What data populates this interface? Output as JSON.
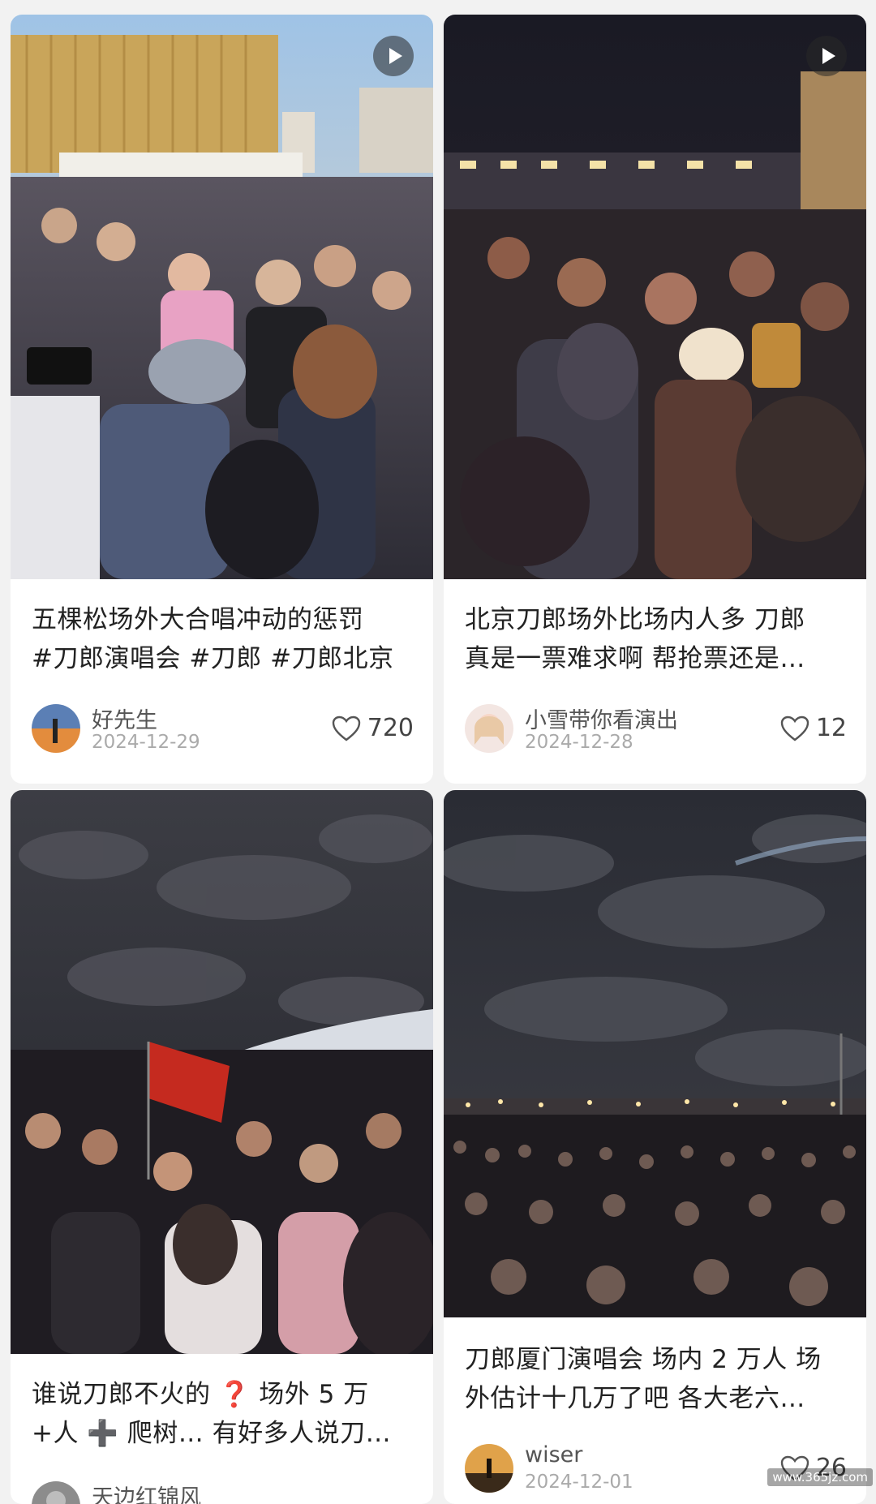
{
  "feed": {
    "cards": [
      {
        "title_line1": "五棵松场外大合唱冲动的惩罚",
        "title_line2": "#刀郎演唱会 #刀郎 #刀郎北京",
        "author": "好先生",
        "date": "2024-12-29",
        "likes": "720",
        "has_video": true,
        "image_alt": "daytime crowd outside arena"
      },
      {
        "title_line1": "北京刀郎场外比场内人多 刀郎",
        "title_line2": "真是一票难求啊 帮抢票还是…",
        "author": "小雪带你看演出",
        "date": "2024-12-28",
        "likes": "12",
        "has_video": true,
        "image_alt": "night crowd with phones"
      },
      {
        "title_line1": "谁说刀郎不火的 ❓ 场外 5 万",
        "title_line2": "+人 ➕ 爬树… 有好多人说刀…",
        "author": "天边红锦风",
        "date": "",
        "likes": "",
        "has_video": false,
        "image_alt": "night crowd with red flag"
      },
      {
        "title_line1": "刀郎厦门演唱会 场内 2 万人 场",
        "title_line2": "外估计十几万了吧 各大老六…",
        "author": "wiser",
        "date": "2024-12-01",
        "likes": "26",
        "has_video": false,
        "image_alt": "massive night crowd under cloudy sky"
      }
    ]
  },
  "watermark": "www.365jz.com",
  "colors": {
    "background": "#f2f2f2",
    "card": "#ffffff",
    "title_text": "#222222",
    "meta_text": "#aaaaaa"
  }
}
